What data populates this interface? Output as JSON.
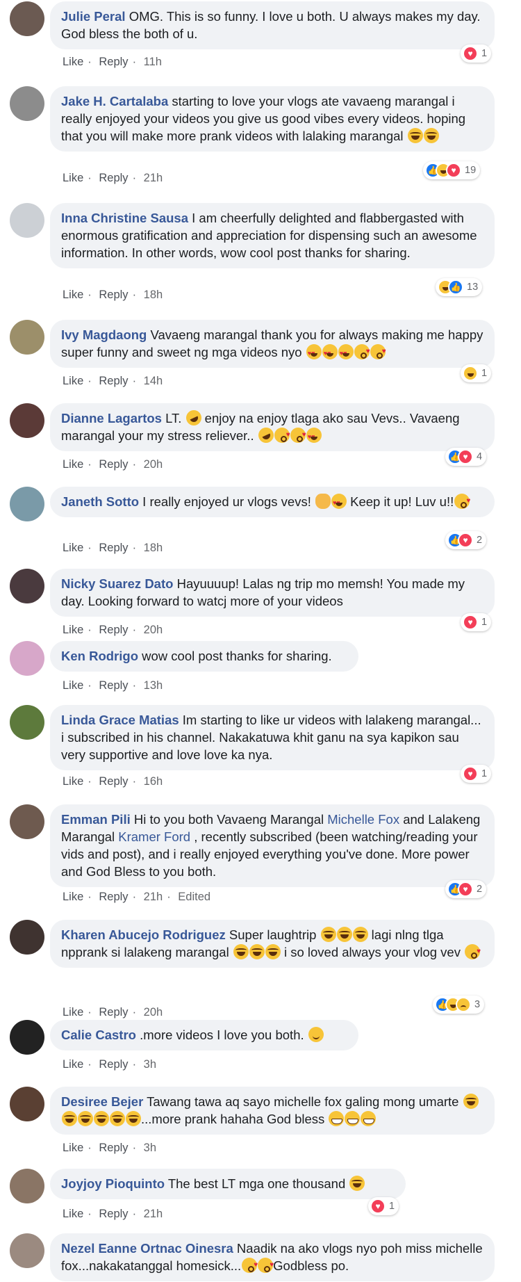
{
  "actions": {
    "like": "Like",
    "reply": "Reply",
    "edited": "Edited"
  },
  "comments": [
    {
      "author": "Julie Peral",
      "text": " OMG. This is so funny. I love u both. U always makes my day. God bless the both of u.",
      "time": "11h",
      "reactions": [
        "love"
      ],
      "count": "1",
      "avatar_color": "#6b5a52"
    },
    {
      "author": "Jake H. Cartalaba",
      "text": " starting to love your vlogs ate vavaeng marangal i really enjoyed your videos you give us good vibes every videos. hoping that you will make more prank videos with lalaking marangal ",
      "time": "21h",
      "reactions": [
        "like",
        "haha",
        "love"
      ],
      "count": "19",
      "avatar_color": "#8c8c8c"
    },
    {
      "author": "Inna Christine Sausa",
      "text": " I am cheerfully delighted and flabbergasted with enormous gratification and appreciation for dispensing such an awesome information. In other words, wow cool post thanks for sharing.",
      "time": "18h",
      "reactions": [
        "haha",
        "like"
      ],
      "count": "13",
      "avatar_color": "#ccd0d5"
    },
    {
      "author": "Ivy Magdaong",
      "text": " Vavaeng marangal thank you for always making me happy super funny and sweet ng mga videos nyo ",
      "time": "14h",
      "reactions": [
        "haha"
      ],
      "count": "1",
      "avatar_color": "#9c8f6a"
    },
    {
      "author": "Dianne Lagartos",
      "text": " LT. ",
      "text2": " enjoy na enjoy tlaga ako sau Vevs.. Vavaeng marangal your my stress reliever.. ",
      "time": "20h",
      "reactions": [
        "like",
        "love"
      ],
      "count": "4",
      "avatar_color": "#5b3a37"
    },
    {
      "author": "Janeth Sotto",
      "text": " I really enjoyed ur vlogs vevs! ",
      "text2": " Keep it up! Luv u!!",
      "time": "18h",
      "reactions": [
        "like",
        "love"
      ],
      "count": "2",
      "avatar_color": "#7a9aa8"
    },
    {
      "author": "Nicky Suarez Dato",
      "text": " Hayuuuup! Lalas ng trip mo memsh! You made my day. Looking forward to watcj more of your videos",
      "time": "20h",
      "reactions": [
        "love"
      ],
      "count": "1",
      "avatar_color": "#4a3a3e"
    },
    {
      "author": "Ken Rodrigo",
      "text": " wow cool post thanks for sharing.",
      "time": "13h",
      "reactions": [],
      "count": "",
      "avatar_color": "#d7a7c9"
    },
    {
      "author": "Linda Grace Matias",
      "text": " Im starting to like ur videos with lalakeng marangal... i subscribed in his channel. Nakakatuwa khit ganu na sya kapikon sau very supportive and love love ka nya.",
      "time": "16h",
      "reactions": [
        "love"
      ],
      "count": "1",
      "avatar_color": "#5d7a3c"
    },
    {
      "author": "Emman Pili",
      "text_a": " Hi to you both Vavaeng Marangal ",
      "mention_a": "Michelle Fox",
      "text_b": " and Lalakeng Marangal ",
      "mention_b": "Kramer Ford",
      "text_c": " , recently subscribed (been watching/reading your vids and post), and i really enjoyed everything you've done. More power and God Bless to you both.",
      "time": "21h",
      "edited": true,
      "reactions": [
        "like",
        "love"
      ],
      "count": "2",
      "avatar_color": "#6e5a4f"
    },
    {
      "author": "Kharen Abucejo Rodriguez",
      "text": " Super laughtrip ",
      "text2": " lagi nlng tlga npprank si lalakeng marangal ",
      "text3": " i so loved always your vlog vev ",
      "time": "20h",
      "reactions": [
        "like",
        "haha",
        "sad"
      ],
      "count": "3",
      "avatar_color": "#3f3330"
    },
    {
      "author": "Calie Castro",
      "text": " .more videos I love you both. ",
      "time": "3h",
      "reactions": [],
      "count": "",
      "avatar_color": "#222222"
    },
    {
      "author": "Desiree Bejer",
      "text": " Tawang tawa aq sayo michelle fox galing mong umarte ",
      "text2": "...more prank hahaha God bless ",
      "time": "3h",
      "reactions": [],
      "count": "",
      "avatar_color": "#5a4033"
    },
    {
      "author": "Joyjoy Pioquinto",
      "text": " The best LT mga one thousand ",
      "time": "21h",
      "reactions": [
        "love"
      ],
      "count": "1",
      "avatar_color": "#8a7565"
    },
    {
      "author": "Nezel Eanne Ortnac Oinesra",
      "text": " Naadik na ako vlogs nyo poh miss michelle fox...nakakatanggal homesick...",
      "text2": "Godbless po.",
      "time": "",
      "reactions": [],
      "count": "",
      "avatar_color": "#9b8a80"
    }
  ]
}
